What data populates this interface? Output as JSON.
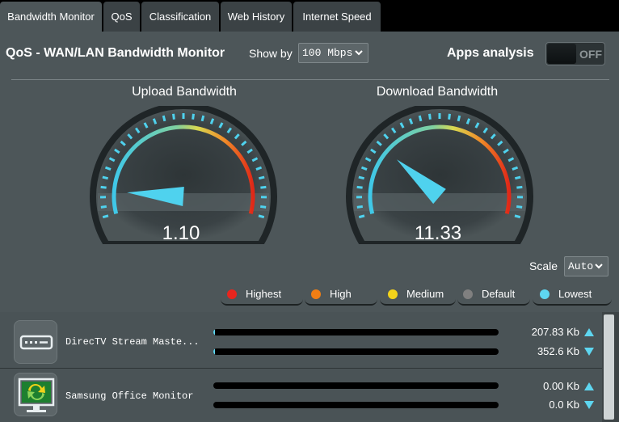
{
  "tabs": [
    {
      "label": "Bandwidth Monitor",
      "active": true
    },
    {
      "label": "QoS",
      "active": false
    },
    {
      "label": "Classification",
      "active": false
    },
    {
      "label": "Web History",
      "active": false
    },
    {
      "label": "Internet Speed",
      "active": false
    }
  ],
  "header": {
    "title": "QoS - WAN/LAN Bandwidth Monitor",
    "show_by_label": "Show by",
    "show_by_value": "100 Mbps",
    "apps_label": "Apps analysis",
    "apps_toggle": "OFF"
  },
  "gauges": {
    "upload": {
      "title": "Upload Bandwidth",
      "value": "1.10",
      "needle_fraction": 0.011
    },
    "download": {
      "title": "Download Bandwidth",
      "value": "11.33",
      "needle_fraction": 0.1133
    }
  },
  "scale": {
    "label": "Scale",
    "value": "Auto"
  },
  "legend": [
    {
      "label": "Highest",
      "color": "#e8251e"
    },
    {
      "label": "High",
      "color": "#f07e14"
    },
    {
      "label": "Medium",
      "color": "#f3d31a"
    },
    {
      "label": "Default",
      "color": "#808080"
    },
    {
      "label": "Lowest",
      "color": "#5ed6f0"
    }
  ],
  "clients": [
    {
      "name": "DirecTV Stream Maste...",
      "icon": "set-top-box-icon",
      "upload": "207.83 Kb",
      "download": "352.6 Kb",
      "upload_fraction": 0.004,
      "download_fraction": 0.005
    },
    {
      "name": "Samsung Office Monitor",
      "icon": "monitor-sync-icon",
      "upload": "0.00 Kb",
      "download": "0.0 Kb",
      "upload_fraction": 0,
      "download_fraction": 0
    }
  ],
  "colors": {
    "accent": "#5ed6f0",
    "background": "#4d5659",
    "tab_bar": "#000000"
  }
}
